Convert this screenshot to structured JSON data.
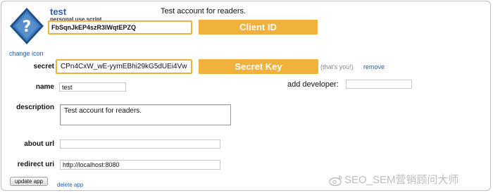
{
  "app": {
    "title": "test",
    "description_heading": "Test account for readers.",
    "script_type_label": "personal use script",
    "client_id": "FbSqnJkEP4szR3lWqtEPZQ",
    "change_icon_label": "change icon",
    "icon_glyph": "?"
  },
  "callouts": {
    "client_id": "Client ID",
    "secret_key": "Secret Key"
  },
  "form": {
    "secret_label": "secret",
    "secret_value": "CPn4CxW_wE-yymEBhi29kG5dUEi4Vw",
    "thats_you": "(that's you!)",
    "remove_label": "remove",
    "name_label": "name",
    "name_value": "test",
    "add_developer_label": "add developer:",
    "add_developer_value": "",
    "description_label": "description",
    "description_value": "Test account for readers.",
    "about_url_label": "about url",
    "about_url_value": "",
    "redirect_uri_label": "redirect uri",
    "redirect_uri_value": "http://localhost:8080",
    "update_button": "update app",
    "delete_link": "delete app"
  },
  "watermark": {
    "text": "SEO_SEM营销顾问大师"
  },
  "colors": {
    "accent": "#f0b23a",
    "link": "#2a5ea8",
    "icon_fill": "#3d7cc0"
  },
  "icons": {
    "app_icon": "question-diamond-icon",
    "watermark_logo": "weibo-icon"
  }
}
